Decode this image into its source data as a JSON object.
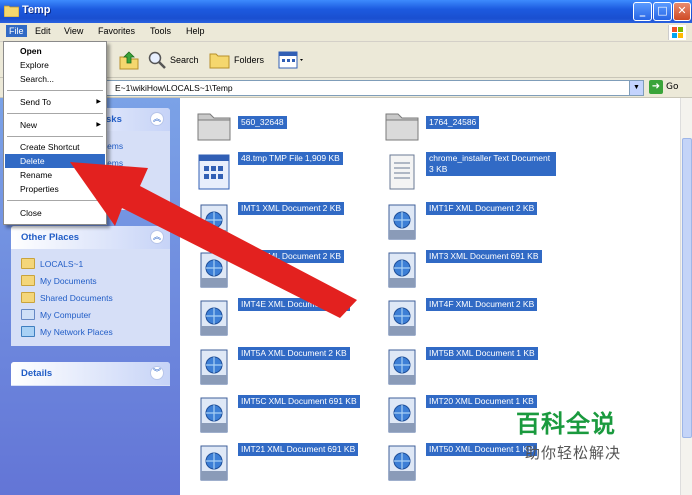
{
  "window": {
    "title": "Temp",
    "minimize_label": "_",
    "maximize_label": "□",
    "close_label": "✕"
  },
  "menubar": {
    "items": [
      "File",
      "Edit",
      "View",
      "Favorites",
      "Tools",
      "Help"
    ]
  },
  "toolbar": {
    "search_label": "Search",
    "folders_label": "Folders"
  },
  "address": {
    "path": "E~1\\wikiHow\\LOCALS~1\\Temp",
    "go_label": "Go"
  },
  "file_menu": {
    "items": [
      "Open",
      "Explore",
      "Search...",
      "Send To",
      "New",
      "Create Shortcut",
      "Delete",
      "Rename",
      "Properties",
      "Close"
    ],
    "highlighted": "Delete"
  },
  "left_pane": {
    "tasks_panel": {
      "title_fragment": "sks",
      "link_fragments": [
        "ed items",
        "ed items",
        "items",
        "items"
      ]
    },
    "other_places": {
      "title": "Other Places",
      "links": [
        "LOCALS~1",
        "My Documents",
        "Shared Documents",
        "My Computer",
        "My Network Places"
      ]
    },
    "details": {
      "title": "Details"
    }
  },
  "files": [
    {
      "name": "560_32648",
      "type": "",
      "size": "",
      "icon": "folder-icon"
    },
    {
      "name": "1764_24586",
      "type": "",
      "size": "",
      "icon": "folder-icon"
    },
    {
      "name": "48.tmp",
      "type": "TMP File",
      "size": "1,909 KB",
      "icon": "tmp-file-icon"
    },
    {
      "name": "chrome_installer",
      "type": "Text Document",
      "size": "3 KB",
      "icon": "text-document-icon"
    },
    {
      "name": "IMT1",
      "type": "XML Document",
      "size": "2 KB",
      "icon": "xml-document-icon"
    },
    {
      "name": "IMT1F",
      "type": "XML Document",
      "size": "2 KB",
      "icon": "xml-document-icon"
    },
    {
      "name": "IMT2",
      "type": "XML Document",
      "size": "2 KB",
      "icon": "xml-document-icon"
    },
    {
      "name": "IMT3",
      "type": "XML Document",
      "size": "691 KB",
      "icon": "xml-document-icon"
    },
    {
      "name": "IMT4E",
      "type": "XML Document",
      "size": "2 KB",
      "icon": "xml-document-icon"
    },
    {
      "name": "IMT4F",
      "type": "XML Document",
      "size": "2 KB",
      "icon": "xml-document-icon"
    },
    {
      "name": "IMT5A",
      "type": "XML Document",
      "size": "2 KB",
      "icon": "xml-document-icon"
    },
    {
      "name": "IMT5B",
      "type": "XML Document",
      "size": "1 KB",
      "icon": "xml-document-icon"
    },
    {
      "name": "IMT5C",
      "type": "XML Document",
      "size": "691 KB",
      "icon": "xml-document-icon"
    },
    {
      "name": "IMT20",
      "type": "XML Document",
      "size": "1 KB",
      "icon": "xml-document-icon"
    },
    {
      "name": "IMT21",
      "type": "XML Document",
      "size": "691 KB",
      "icon": "xml-document-icon"
    },
    {
      "name": "IMT50",
      "type": "XML Document",
      "size": "1 KB",
      "icon": "xml-document-icon"
    }
  ],
  "watermark": {
    "line1": "百科全说",
    "line2": "助你轻松解决"
  },
  "colors": {
    "selection": "#316ac5",
    "arrow": "#e02020",
    "titlebar": "#1c5adf"
  }
}
